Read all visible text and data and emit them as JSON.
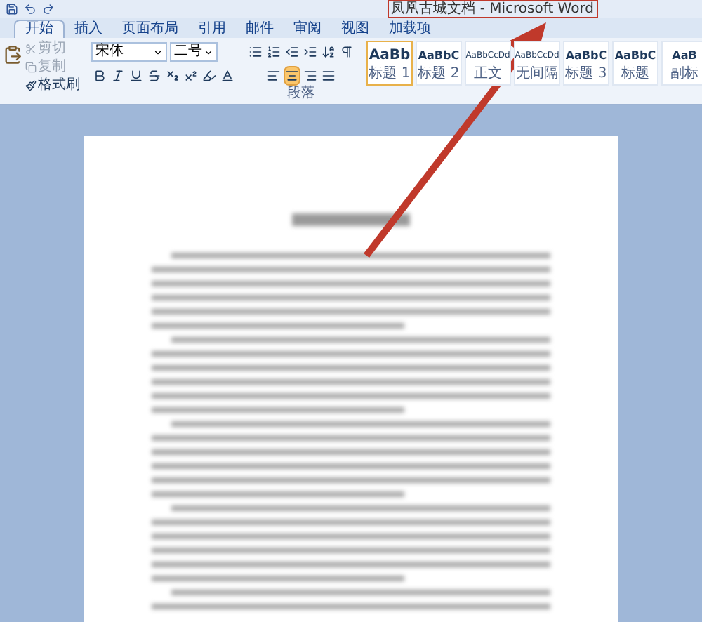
{
  "window": {
    "title": "凤凰古城文档 - Microsoft Word"
  },
  "tabs": [
    {
      "label": "开始",
      "selected": true
    },
    {
      "label": "插入",
      "selected": false
    },
    {
      "label": "页面布局",
      "selected": false
    },
    {
      "label": "引用",
      "selected": false
    },
    {
      "label": "邮件",
      "selected": false
    },
    {
      "label": "审阅",
      "selected": false
    },
    {
      "label": "视图",
      "selected": false
    },
    {
      "label": "加载项",
      "selected": false
    }
  ],
  "clipboard": {
    "items": [
      {
        "label": "剪切",
        "disabled": true
      },
      {
        "label": "复制",
        "disabled": true
      },
      {
        "label": "格式刷",
        "disabled": false
      }
    ]
  },
  "font": {
    "name": "宋体",
    "size": "二号"
  },
  "paragraph": {
    "group_label": "段落"
  },
  "styles": [
    {
      "preview": "AaBb",
      "label": "标题 1",
      "selected": true
    },
    {
      "preview": "AaBbC",
      "label": "标题 2",
      "selected": false
    },
    {
      "preview": "AaBbCcDd",
      "label": "正文",
      "selected": false
    },
    {
      "preview": "AaBbCcDd",
      "label": "无间隔",
      "selected": false
    },
    {
      "preview": "AaBbC",
      "label": "标题 3",
      "selected": false
    },
    {
      "preview": "AaBbC",
      "label": "标题",
      "selected": false
    },
    {
      "preview": "AaB",
      "label": "副标",
      "selected": false
    }
  ]
}
